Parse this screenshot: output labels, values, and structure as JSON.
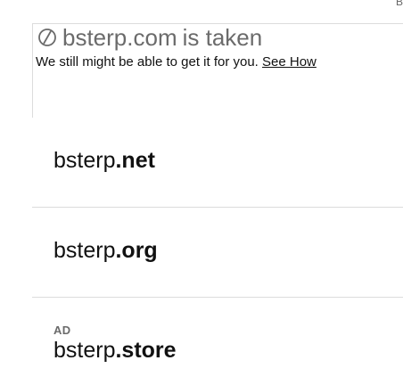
{
  "corner_fragment": "B",
  "taken": {
    "icon": "unavailable-icon",
    "domain": "bsterp.com",
    "status": "is taken",
    "message": "We still might be able to get it for you.",
    "link_label": "See How"
  },
  "suggestions": [
    {
      "ad_label": "",
      "sld": "bsterp",
      "tld": ".net"
    },
    {
      "ad_label": "",
      "sld": "bsterp",
      "tld": ".org"
    },
    {
      "ad_label": "AD",
      "sld": "bsterp",
      "tld": ".store"
    }
  ]
}
